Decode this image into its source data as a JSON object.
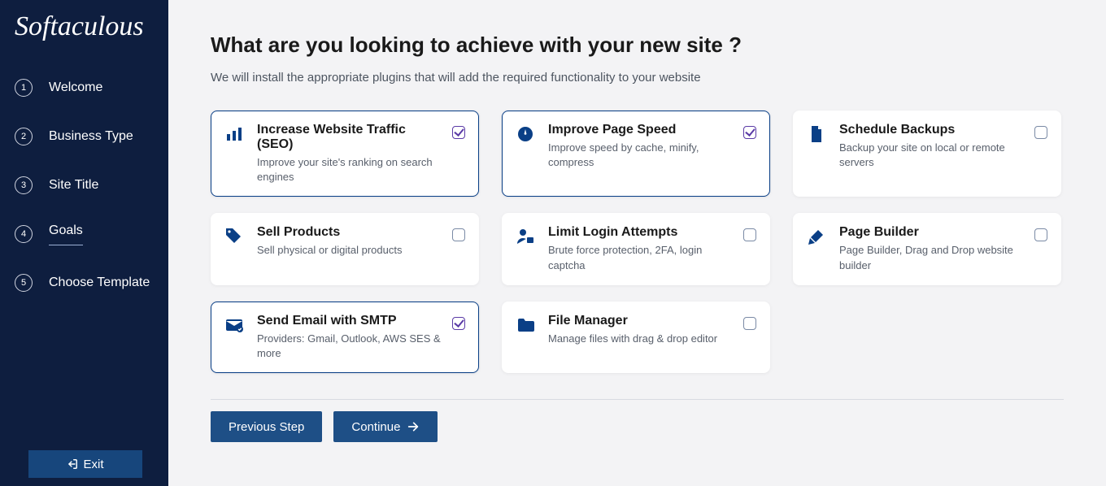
{
  "brand": "Softaculous",
  "sidebar": {
    "steps": [
      {
        "num": "1",
        "label": "Welcome"
      },
      {
        "num": "2",
        "label": "Business Type"
      },
      {
        "num": "3",
        "label": "Site Title"
      },
      {
        "num": "4",
        "label": "Goals"
      },
      {
        "num": "5",
        "label": "Choose Template"
      }
    ],
    "active_index": 3,
    "exit_label": "Exit"
  },
  "heading": "What are you looking to achieve with your new site ?",
  "subheading": "We will install the appropriate plugins that will add the required functionality to your website",
  "goals": [
    {
      "id": "seo",
      "title": "Increase Website Traffic (SEO)",
      "desc": "Improve your site's ranking on search engines",
      "selected": true,
      "icon": "chart-bar"
    },
    {
      "id": "speed",
      "title": "Improve Page Speed",
      "desc": "Improve speed by cache, minify, compress",
      "selected": true,
      "icon": "gauge"
    },
    {
      "id": "backup",
      "title": "Schedule Backups",
      "desc": "Backup your site on local or remote servers",
      "selected": false,
      "icon": "file"
    },
    {
      "id": "sell",
      "title": "Sell Products",
      "desc": "Sell physical or digital products",
      "selected": false,
      "icon": "tag"
    },
    {
      "id": "login",
      "title": "Limit Login Attempts",
      "desc": "Brute force protection, 2FA, login captcha",
      "selected": false,
      "icon": "user-lock"
    },
    {
      "id": "builder",
      "title": "Page Builder",
      "desc": "Page Builder, Drag and Drop website builder",
      "selected": false,
      "icon": "brush"
    },
    {
      "id": "smtp",
      "title": "Send Email with SMTP",
      "desc": "Providers: Gmail, Outlook, AWS SES & more",
      "selected": true,
      "icon": "envelope"
    },
    {
      "id": "filemgr",
      "title": "File Manager",
      "desc": "Manage files with drag & drop editor",
      "selected": false,
      "icon": "folder"
    }
  ],
  "buttons": {
    "prev": "Previous Step",
    "next": "Continue"
  }
}
